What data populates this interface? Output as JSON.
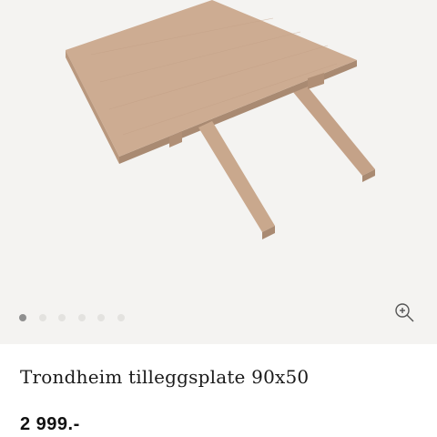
{
  "product": {
    "title": "Trondheim tilleggsplate 90x50",
    "price": "2 999.-"
  },
  "gallery": {
    "image_count": 6,
    "active_index": 0,
    "zoom_icon": "zoom-in-icon"
  },
  "colors": {
    "gallery_background": "#f4f3f1",
    "wood": "#c9a88d",
    "dot_active": "#8f8f8f",
    "dot_inactive": "#e3e2df"
  }
}
